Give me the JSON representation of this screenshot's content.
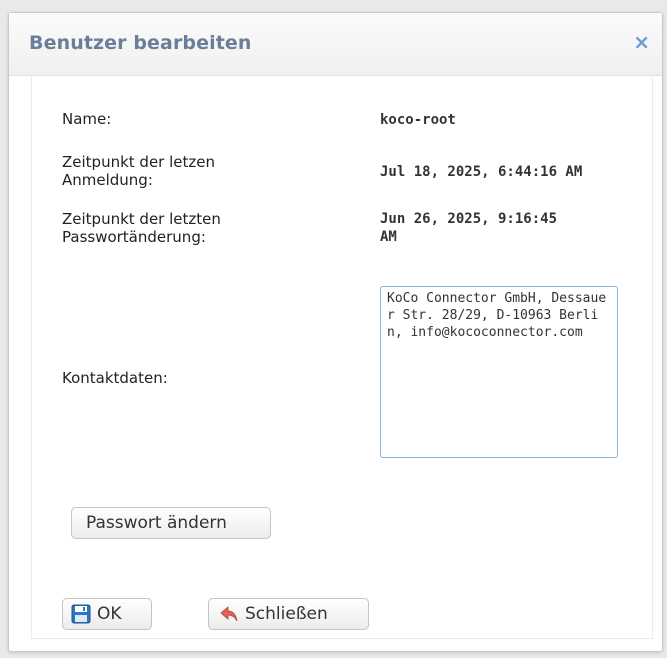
{
  "dialog": {
    "title": "Benutzer bearbeiten",
    "close_symbol": "×"
  },
  "fields": {
    "name_label": "Name:",
    "name_value": "koco-root",
    "last_login_label_line1": "Zeitpunkt der letzen",
    "last_login_label_line2": "Anmeldung:",
    "last_login_value": "Jul 18, 2025, 6:44:16 AM",
    "last_pw_change_label_line1": "Zeitpunkt der letzten",
    "last_pw_change_label_line2": "Passwortänderung:",
    "last_pw_change_value_line1": "Jun 26, 2025, 9:16:45",
    "last_pw_change_value_line2": "AM",
    "contact_label": "Kontaktdaten:",
    "contact_value": "KoCo Connector GmbH, Dessauer Str. 28/29, D-10963 Berlin, info@kococonnector.com"
  },
  "buttons": {
    "change_password": "Passwort ändern",
    "ok": "OK",
    "close": "Schließen"
  },
  "icons": {
    "close": "close-icon",
    "save": "floppy-disk-icon",
    "back": "undo-arrow-icon"
  },
  "colors": {
    "title": "#6a7f97",
    "close_x": "#6f9bd4",
    "input_border": "#8fb3e0"
  }
}
